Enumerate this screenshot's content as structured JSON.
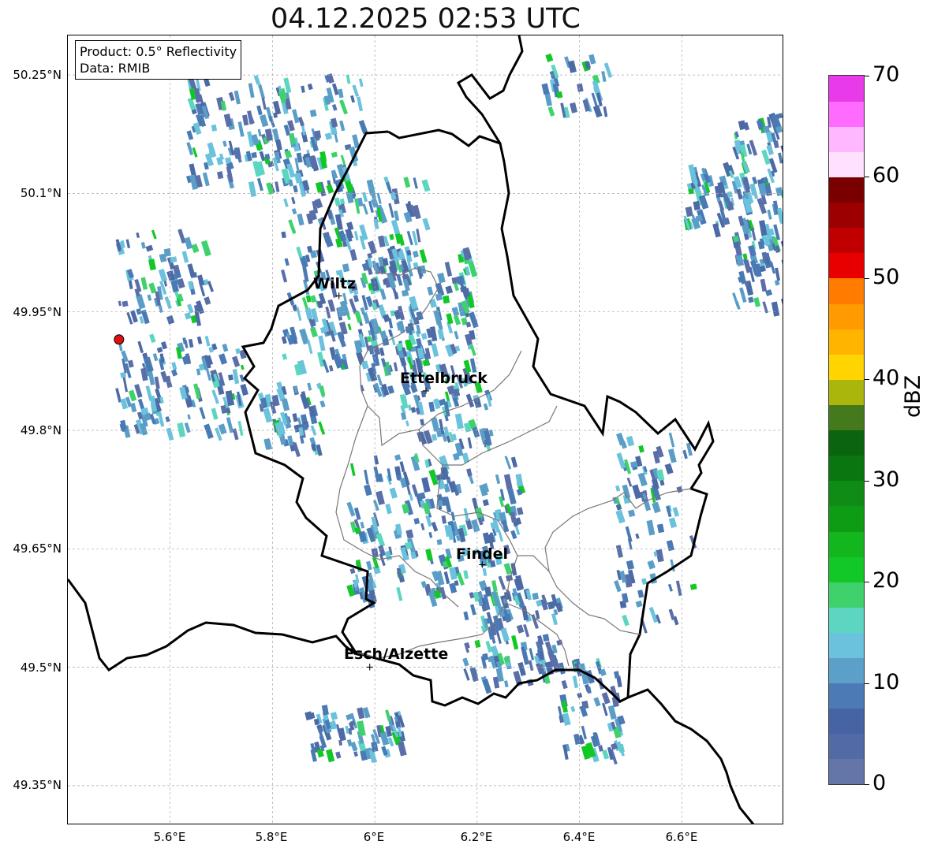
{
  "title": "04.12.2025 02:53 UTC",
  "info": {
    "product": "Product: 0.5° Reflectivity",
    "data": "Data: RMIB"
  },
  "colorbar": {
    "unit": "dBZ",
    "min": 0,
    "max": 70,
    "ticks": [
      "0",
      "10",
      "20",
      "30",
      "40",
      "50",
      "60",
      "70"
    ],
    "colors": [
      "#6475a8",
      "#526aa6",
      "#4663a4",
      "#4c7ab4",
      "#5c9fc8",
      "#6ac2dc",
      "#5cd6c0",
      "#3fd26c",
      "#12c826",
      "#14b61e",
      "#0e9c14",
      "#0e8c16",
      "#0a7610",
      "#0a6410",
      "#457a1c",
      "#aab60c",
      "#ffd400",
      "#ffb400",
      "#ff9a00",
      "#ff7c00",
      "#e80000",
      "#c00000",
      "#9c0000",
      "#7a0000",
      "#ffe0ff",
      "#ffb8ff",
      "#ff6aff",
      "#e83ae8"
    ]
  },
  "axes": {
    "lat_ticks": [
      "50.25°N",
      "50.1°N",
      "49.95°N",
      "49.8°N",
      "49.65°N",
      "49.5°N",
      "49.35°N"
    ],
    "lon_ticks": [
      "5.6°E",
      "5.8°E",
      "6°E",
      "6.2°E",
      "6.4°E",
      "6.6°E"
    ],
    "lon_range": [
      5.4,
      6.8
    ],
    "lat_range": [
      49.3,
      50.3
    ]
  },
  "cities": [
    {
      "name": "Wiltz",
      "lon": 5.93,
      "lat": 49.97
    },
    {
      "name": "Ettelbruck",
      "lon": 6.1,
      "lat": 49.85
    },
    {
      "name": "Findel",
      "lon": 6.21,
      "lat": 49.63
    },
    {
      "name": "Esch/Alzette",
      "lon": 5.99,
      "lat": 49.5
    }
  ],
  "radar_site": {
    "lon": 5.5,
    "lat": 49.915,
    "color": "#e01010"
  }
}
